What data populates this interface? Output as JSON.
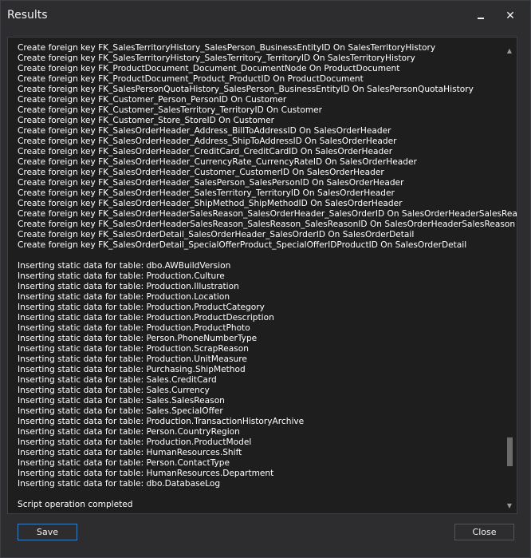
{
  "window": {
    "title": "Results",
    "minimize_icon": "minimize-icon",
    "close_icon": "close-icon",
    "close_glyph": "✕"
  },
  "log": {
    "lines": [
      "Create foreign key FK_SalesTerritoryHistory_SalesPerson_BusinessEntityID On SalesTerritoryHistory",
      "Create foreign key FK_SalesTerritoryHistory_SalesTerritory_TerritoryID On SalesTerritoryHistory",
      "Create foreign key FK_ProductDocument_Document_DocumentNode On ProductDocument",
      "Create foreign key FK_ProductDocument_Product_ProductID On ProductDocument",
      "Create foreign key FK_SalesPersonQuotaHistory_SalesPerson_BusinessEntityID On SalesPersonQuotaHistory",
      "Create foreign key FK_Customer_Person_PersonID On Customer",
      "Create foreign key FK_Customer_SalesTerritory_TerritoryID On Customer",
      "Create foreign key FK_Customer_Store_StoreID On Customer",
      "Create foreign key FK_SalesOrderHeader_Address_BillToAddressID On SalesOrderHeader",
      "Create foreign key FK_SalesOrderHeader_Address_ShipToAddressID On SalesOrderHeader",
      "Create foreign key FK_SalesOrderHeader_CreditCard_CreditCardID On SalesOrderHeader",
      "Create foreign key FK_SalesOrderHeader_CurrencyRate_CurrencyRateID On SalesOrderHeader",
      "Create foreign key FK_SalesOrderHeader_Customer_CustomerID On SalesOrderHeader",
      "Create foreign key FK_SalesOrderHeader_SalesPerson_SalesPersonID On SalesOrderHeader",
      "Create foreign key FK_SalesOrderHeader_SalesTerritory_TerritoryID On SalesOrderHeader",
      "Create foreign key FK_SalesOrderHeader_ShipMethod_ShipMethodID On SalesOrderHeader",
      "Create foreign key FK_SalesOrderHeaderSalesReason_SalesOrderHeader_SalesOrderID On SalesOrderHeaderSalesReason",
      "Create foreign key FK_SalesOrderHeaderSalesReason_SalesReason_SalesReasonID On SalesOrderHeaderSalesReason",
      "Create foreign key FK_SalesOrderDetail_SalesOrderHeader_SalesOrderID On SalesOrderDetail",
      "Create foreign key FK_SalesOrderDetail_SpecialOfferProduct_SpecialOfferIDProductID On SalesOrderDetail",
      "",
      "Inserting static data for table: dbo.AWBuildVersion",
      "Inserting static data for table: Production.Culture",
      "Inserting static data for table: Production.Illustration",
      "Inserting static data for table: Production.Location",
      "Inserting static data for table: Production.ProductCategory",
      "Inserting static data for table: Production.ProductDescription",
      "Inserting static data for table: Production.ProductPhoto",
      "Inserting static data for table: Person.PhoneNumberType",
      "Inserting static data for table: Production.ScrapReason",
      "Inserting static data for table: Production.UnitMeasure",
      "Inserting static data for table: Purchasing.ShipMethod",
      "Inserting static data for table: Sales.CreditCard",
      "Inserting static data for table: Sales.Currency",
      "Inserting static data for table: Sales.SalesReason",
      "Inserting static data for table: Sales.SpecialOffer",
      "Inserting static data for table: Production.TransactionHistoryArchive",
      "Inserting static data for table: Person.CountryRegion",
      "Inserting static data for table: Production.ProductModel",
      "Inserting static data for table: HumanResources.Shift",
      "Inserting static data for table: Person.ContactType",
      "Inserting static data for table: HumanResources.Department",
      "Inserting static data for table: dbo.DatabaseLog",
      "",
      "Script operation completed"
    ],
    "scroll_up_icon": "scroll-up-icon",
    "scroll_down_icon": "scroll-down-icon"
  },
  "buttons": {
    "save_label": "Save",
    "close_label": "Close"
  },
  "colors": {
    "background": "#2d2d30",
    "panel": "#1e1e1e",
    "text": "#ffffff",
    "focus_border": "#3d7fc2"
  }
}
